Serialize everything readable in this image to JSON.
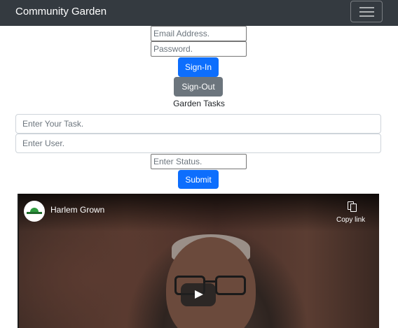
{
  "navbar": {
    "brand": "Community Garden",
    "toggler_icon": "hamburger-icon"
  },
  "auth": {
    "email_placeholder": "Email Address.",
    "password_placeholder": "Password.",
    "signin_label": "Sign-In",
    "signout_label": "Sign-Out"
  },
  "tasks": {
    "heading": "Garden Tasks",
    "task_placeholder": "Enter Your Task.",
    "user_placeholder": "Enter User.",
    "status_placeholder": "Enter Status.",
    "submit_label": "Submit"
  },
  "video": {
    "title": "Harlem Grown",
    "copy_link_label": "Copy link",
    "copy_icon": "copy-icon",
    "play_icon": "play-icon"
  },
  "colors": {
    "navbar_bg": "#343a40",
    "primary": "#0d6efd",
    "secondary": "#6c757d"
  }
}
